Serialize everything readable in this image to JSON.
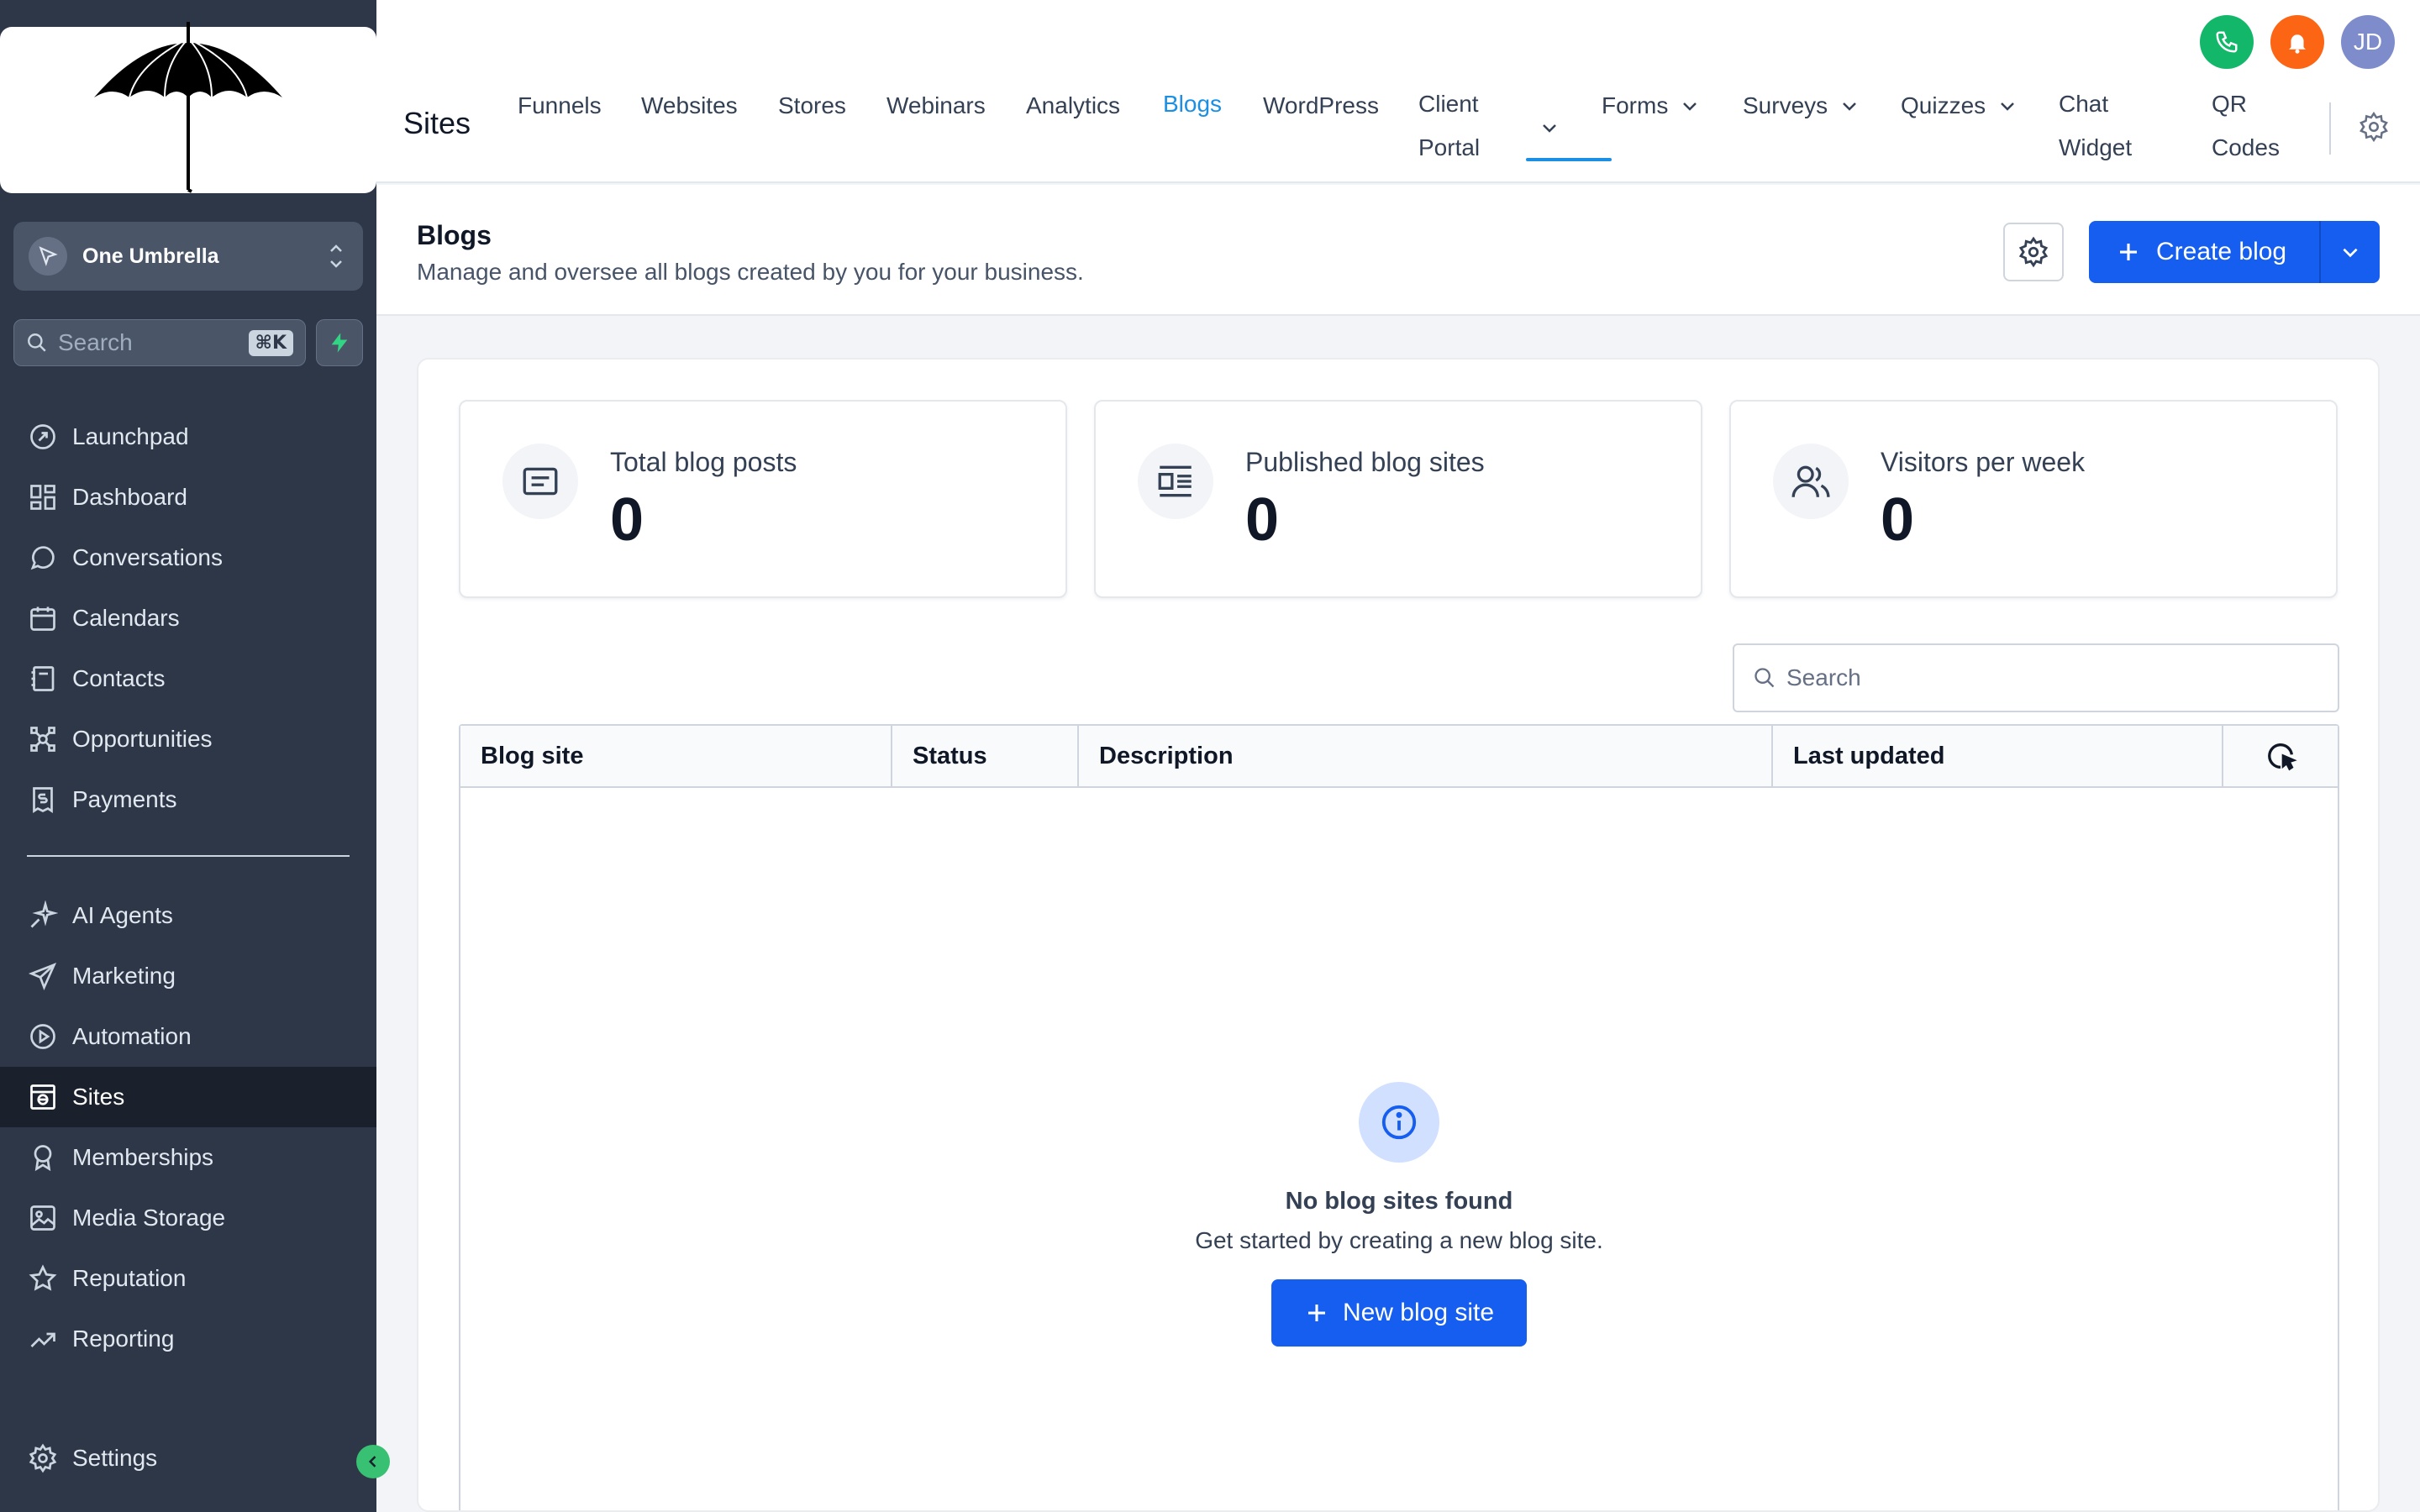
{
  "sidebar": {
    "account_name": "One Umbrella",
    "search_placeholder": "Search",
    "search_shortcut": "⌘K",
    "items": [
      {
        "label": "Launchpad",
        "icon": "launchpad-icon"
      },
      {
        "label": "Dashboard",
        "icon": "dashboard-icon"
      },
      {
        "label": "Conversations",
        "icon": "chat-bubble-icon"
      },
      {
        "label": "Calendars",
        "icon": "calendar-icon"
      },
      {
        "label": "Contacts",
        "icon": "contacts-icon"
      },
      {
        "label": "Opportunities",
        "icon": "opportunities-icon"
      },
      {
        "label": "Payments",
        "icon": "payments-icon"
      }
    ],
    "items2": [
      {
        "label": "AI Agents",
        "icon": "sparkle-icon"
      },
      {
        "label": "Marketing",
        "icon": "send-icon"
      },
      {
        "label": "Automation",
        "icon": "automation-icon"
      },
      {
        "label": "Sites",
        "icon": "sites-icon",
        "active": true
      },
      {
        "label": "Memberships",
        "icon": "badge-icon"
      },
      {
        "label": "Media Storage",
        "icon": "image-icon"
      },
      {
        "label": "Reputation",
        "icon": "star-icon"
      },
      {
        "label": "Reporting",
        "icon": "trend-icon"
      }
    ],
    "settings_label": "Settings"
  },
  "header": {
    "title": "Sites",
    "avatar_initials": "JD",
    "tabs": {
      "funnels": "Funnels",
      "websites": "Websites",
      "stores": "Stores",
      "webinars": "Webinars",
      "analytics": "Analytics",
      "blogs": "Blogs",
      "wordpress": "WordPress",
      "client_portal_1": "Client",
      "client_portal_2": "Portal",
      "forms": "Forms",
      "surveys": "Surveys",
      "quizzes": "Quizzes",
      "chat_widget_1": "Chat",
      "chat_widget_2": "Widget",
      "qr_codes_1": "QR",
      "qr_codes_2": "Codes"
    },
    "active_tab": "Blogs"
  },
  "content": {
    "title": "Blogs",
    "subtitle": "Manage and oversee all blogs created by you for your business.",
    "create_label": "Create blog"
  },
  "stats": [
    {
      "label": "Total blog posts",
      "value": "0"
    },
    {
      "label": "Published blog sites",
      "value": "0"
    },
    {
      "label": "Visitors per week",
      "value": "0"
    }
  ],
  "table": {
    "search_placeholder": "Search",
    "columns": [
      "Blog site",
      "Status",
      "Description",
      "Last updated"
    ],
    "empty_title": "No blog sites found",
    "empty_subtitle": "Get started by creating a new blog site.",
    "new_button_label": "New blog site"
  },
  "colors": {
    "sidebar_bg": "#2d3748",
    "primary": "#155eef",
    "active_tab": "#1a8fe3",
    "phone": "#12b76a",
    "bell": "#fb6514"
  }
}
